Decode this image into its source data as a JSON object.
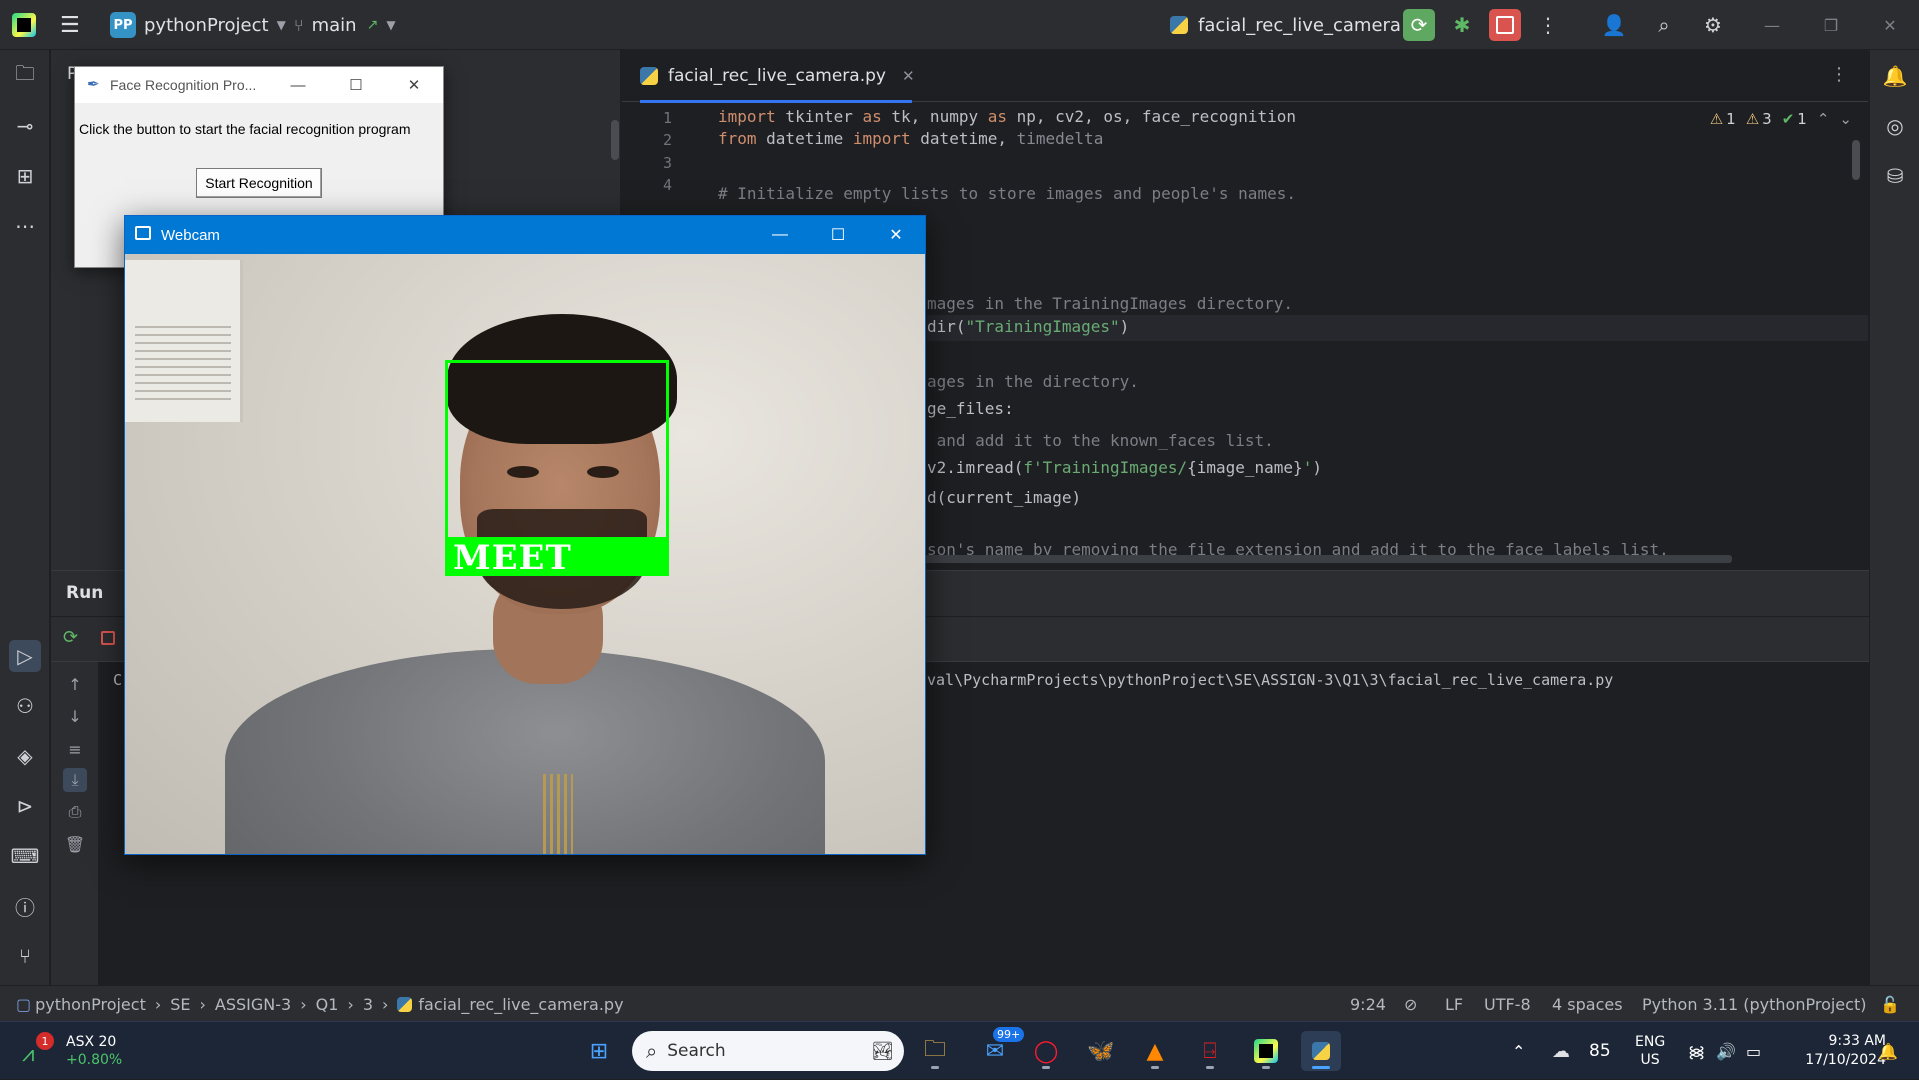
{
  "ide": {
    "project_name": "pythonProject",
    "project_badge": "PP",
    "branch": "main",
    "run_config": "facial_rec_live_camera",
    "left_strip_icons": [
      "folder-icon",
      "commit-icon",
      "structure-icon",
      "more-icon",
      "run-icon",
      "python-console-icon",
      "layers-icon",
      "services-icon",
      "terminal-icon",
      "problems-icon",
      "git-icon"
    ],
    "right_strip_icons": [
      "notifications-icon",
      "ai-assistant-icon",
      "database-icon"
    ]
  },
  "project_panel": {
    "header_initial": "P",
    "partial_item_initial": "C"
  },
  "editor": {
    "tab_label": "facial_rec_live_camera.py",
    "inspections": {
      "warnings_a": "1",
      "warnings_b": "3",
      "ok": "1"
    },
    "line_numbers": [
      "1",
      "2",
      "3",
      "4"
    ],
    "lines": {
      "l1_kw1": "import",
      "l1_a": " tkinter ",
      "l1_kw2": "as",
      "l1_b": " tk, numpy ",
      "l1_kw3": "as",
      "l1_c": " np, cv2, os, face_recognition",
      "l2_kw1": "from",
      "l2_a": " datetime ",
      "l2_kw2": "import",
      "l2_b": " datetime, ",
      "l2_dim": "timedelta",
      "l4_cmt": "# Initialize empty lists to store images and people's names.",
      "frag1": "mages in the TrainingImages directory.",
      "frag2_a": "dir(",
      "frag2_str": "\"TrainingImages\"",
      "frag2_b": ")",
      "frag3": "ages in the directory.",
      "frag4": "ge_files:",
      "frag5": " and add it to the known_faces list.",
      "frag6_a": "v2.imread(",
      "frag6_str": "f'TrainingImages/",
      "frag6_b": "{image_name}",
      "frag6_str2": "'",
      "frag6_c": ")",
      "frag7": "d(current_image)",
      "frag8": "son's name by removing the file extension and add it to the face_labels list."
    }
  },
  "run_panel": {
    "title": "Run",
    "console_path": "val\\PycharmProjects\\pythonProject\\SE\\ASSIGN-3\\Q1\\3\\facial_rec_live_camera.py"
  },
  "statusbar": {
    "breadcrumb": [
      "pythonProject",
      "SE",
      "ASSIGN-3",
      "Q1",
      "3",
      "facial_rec_live_camera.py"
    ],
    "position": "9:24",
    "line_sep": "LF",
    "encoding": "UTF-8",
    "indent": "4 spaces",
    "interpreter": "Python 3.11 (pythonProject)"
  },
  "tk_window": {
    "title": "Face Recognition Pro...",
    "label": "Click the button to start the facial recognition program",
    "button": "Start Recognition"
  },
  "webcam": {
    "title": "Webcam",
    "detected_name": "MEET"
  },
  "taskbar": {
    "stock_name": "ASX 20",
    "stock_change": "+0.80%",
    "stock_badge": "1",
    "search_placeholder": "Search",
    "mail_badge": "99+",
    "weather_temp": "85",
    "lang_1": "ENG",
    "lang_2": "US",
    "time": "9:33 AM",
    "date": "17/10/2024"
  },
  "colors": {
    "accent": "#3574f0",
    "face_box": "#00ff00",
    "run_button": "#5fa861",
    "stop_button": "#d9534f"
  }
}
